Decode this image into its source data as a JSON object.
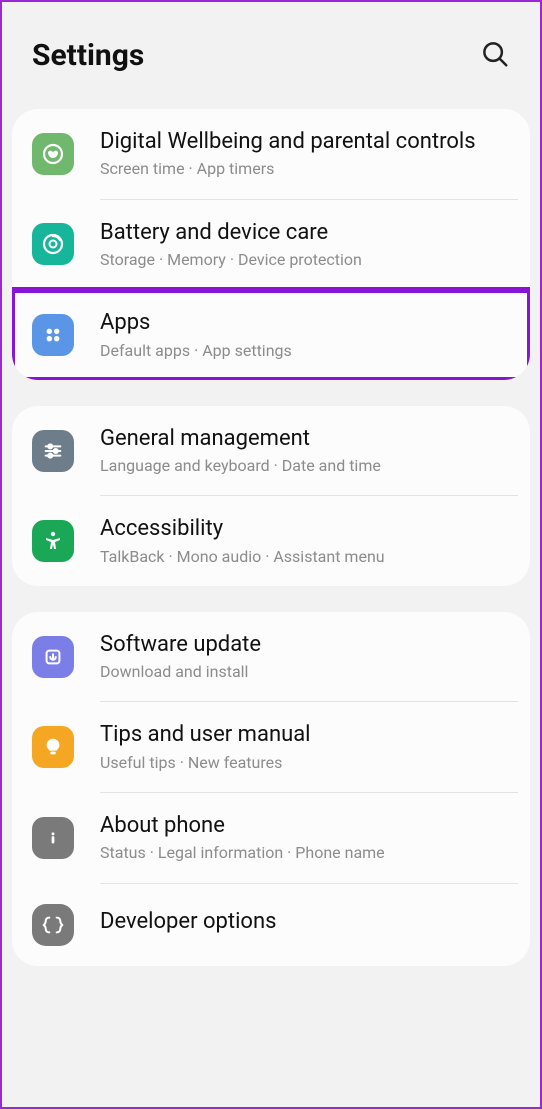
{
  "header": {
    "title": "Settings"
  },
  "groups": [
    {
      "items": [
        {
          "key": "wellbeing",
          "title": "Digital Wellbeing and parental controls",
          "sub": "Screen time  ·  App timers"
        },
        {
          "key": "battery",
          "title": "Battery and device care",
          "sub": "Storage  ·  Memory  ·  Device protection"
        },
        {
          "key": "apps",
          "title": "Apps",
          "sub": "Default apps  ·  App settings",
          "highlighted": true
        }
      ]
    },
    {
      "items": [
        {
          "key": "general",
          "title": "General management",
          "sub": "Language and keyboard  ·  Date and time"
        },
        {
          "key": "access",
          "title": "Accessibility",
          "sub": "TalkBack  ·  Mono audio  ·  Assistant menu"
        }
      ]
    },
    {
      "items": [
        {
          "key": "software",
          "title": "Software update",
          "sub": "Download and install"
        },
        {
          "key": "tips",
          "title": "Tips and user manual",
          "sub": "Useful tips  ·  New features"
        },
        {
          "key": "about",
          "title": "About phone",
          "sub": "Status  ·  Legal information  ·  Phone name"
        },
        {
          "key": "dev",
          "title": "Developer options",
          "sub": ""
        }
      ]
    }
  ]
}
